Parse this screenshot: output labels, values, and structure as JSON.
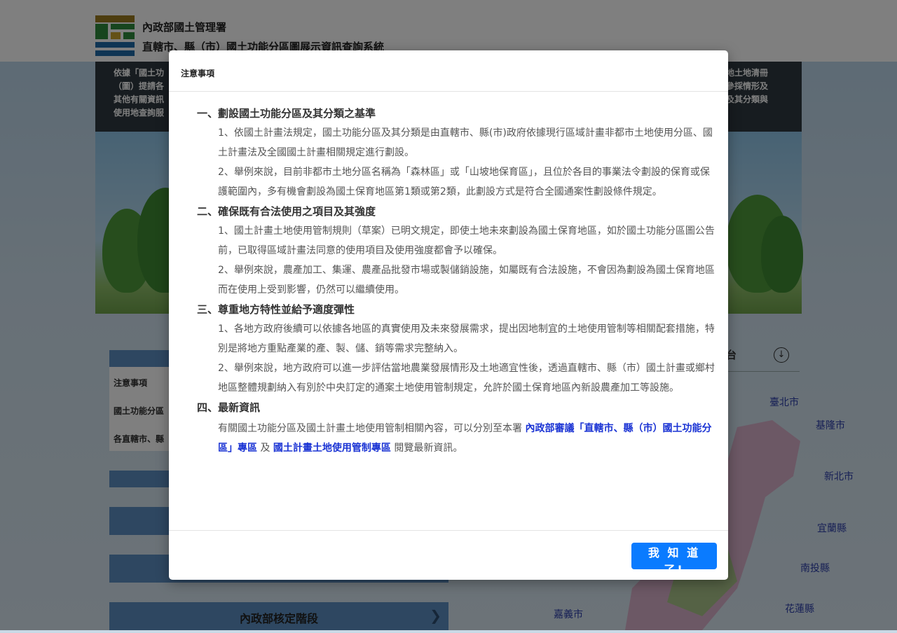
{
  "header": {
    "org_name": "內政部國土管理署",
    "system_name": "直轄市、縣（市）國土功能分區圖展示資訊查詢系統"
  },
  "banner": {
    "left_text": "依據「國土功\n（圖）提請各\n其他有關資訊\n使用地查詢服",
    "right_text": "用地土地清冊\n及參採情形及\n區及其分類與"
  },
  "sidebar": {
    "items": [
      {
        "label": "注意事項"
      },
      {
        "label": "國土功能分區"
      },
      {
        "label": "各直轄市、縣"
      }
    ]
  },
  "stage_bar": {
    "label": "內政部核定階段"
  },
  "map": {
    "title_fragment": "台",
    "cities": [
      "臺北市",
      "基隆市",
      "新北市",
      "宜蘭縣",
      "南投縣",
      "花蓮縣",
      "嘉義市"
    ]
  },
  "modal": {
    "title": "注意事項",
    "sections": [
      {
        "title": "一、劃設國土功能分區及其分類之基準",
        "paras": [
          "1、依國土計畫法規定，國土功能分區及其分類是由直轄市、縣(市)政府依據現行區域計畫非都市土地使用分區、國土計畫法及全國國土計畫相關規定進行劃設。",
          "2、舉例來說，目前非都市土地分區名稱為「森林區」或「山坡地保育區」，且位於各目的事業法令劃設的保育或保護範圍內，多有機會劃設為國土保育地區第1類或第2類，此劃設方式是符合全國通案性劃設條件規定。"
        ]
      },
      {
        "title": "二、確保既有合法使用之項目及其強度",
        "paras": [
          "1、國土計畫土地使用管制規則（草案）已明文規定，即使土地未來劃設為國土保育地區，如於國土功能分區圖公告前，已取得區域計畫法同意的使用項目及使用強度都會予以確保。",
          "2、舉例來說，農產加工、集運、農產品批發市場或製儲銷設施，如屬既有合法設施，不會因為劃設為國土保育地區而在使用上受到影響，仍然可以繼續使用。"
        ]
      },
      {
        "title": "三、尊重地方特性並給予適度彈性",
        "paras": [
          "1、各地方政府後續可以依據各地區的真實使用及未來發展需求，提出因地制宜的土地使用管制等相關配套措施，特別是將地方重點產業的產、製、儲、銷等需求完整納入。",
          "2、舉例來說，地方政府可以進一步評估當地農業發展情形及土地適宜性後，透過直轄市、縣（市）國土計畫或鄉村地區整體規劃納入有別於中央訂定的通案土地使用管制規定，允許於國土保育地區內新設農產加工等設施。"
        ]
      },
      {
        "title": "四、最新資訊",
        "latest_prefix": "有關國土功能分區及國土計畫土地使用管制相關內容，可以分別至本署 ",
        "link1": "內政部審議「直轄市、縣（市）國土功能分區」專區",
        "latest_mid": " 及 ",
        "link2": "國土計畫土地使用管制專區",
        "latest_suffix": " 閱覽最新資訊。"
      }
    ],
    "ok_button": "我 知 道 了!"
  }
}
